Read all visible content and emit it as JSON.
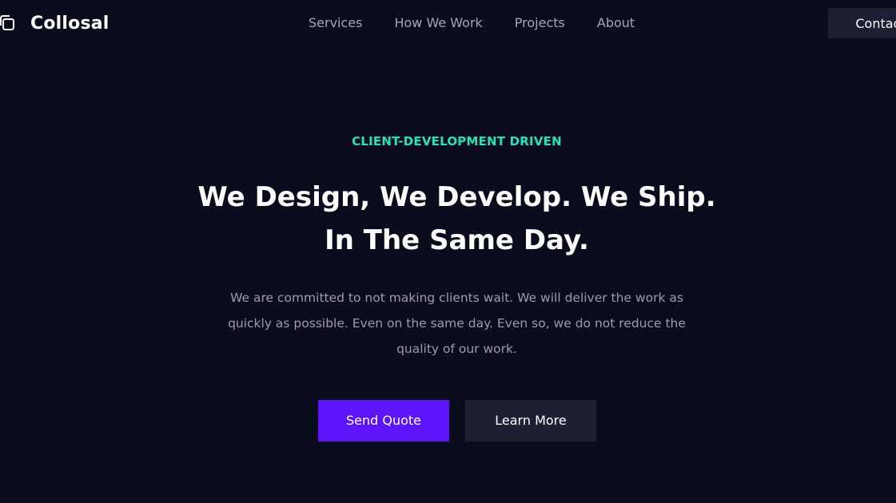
{
  "brand": {
    "name": "Collosal",
    "icon": "copy-squares-icon"
  },
  "nav": {
    "items": [
      {
        "label": "Services"
      },
      {
        "label": "How We Work"
      },
      {
        "label": "Projects"
      },
      {
        "label": "About"
      }
    ],
    "contact_label": "Contact"
  },
  "hero": {
    "eyebrow": "CLIENT-DEVELOPMENT DRIVEN",
    "headline_line1": "We Design, We Develop. We Ship.",
    "headline_line2": "In The Same Day.",
    "description": "We are committed to not making clients wait. We will deliver the work as quickly as possible. Even on the same day. Even so, we do not reduce the quality of our work.",
    "primary_button": "Send Quote",
    "secondary_button": "Learn More"
  },
  "colors": {
    "background": "#0b0b1e",
    "accent_teal": "#22e3c0",
    "primary_purple": "#5d14fa",
    "secondary_dark": "#1f1f33"
  }
}
